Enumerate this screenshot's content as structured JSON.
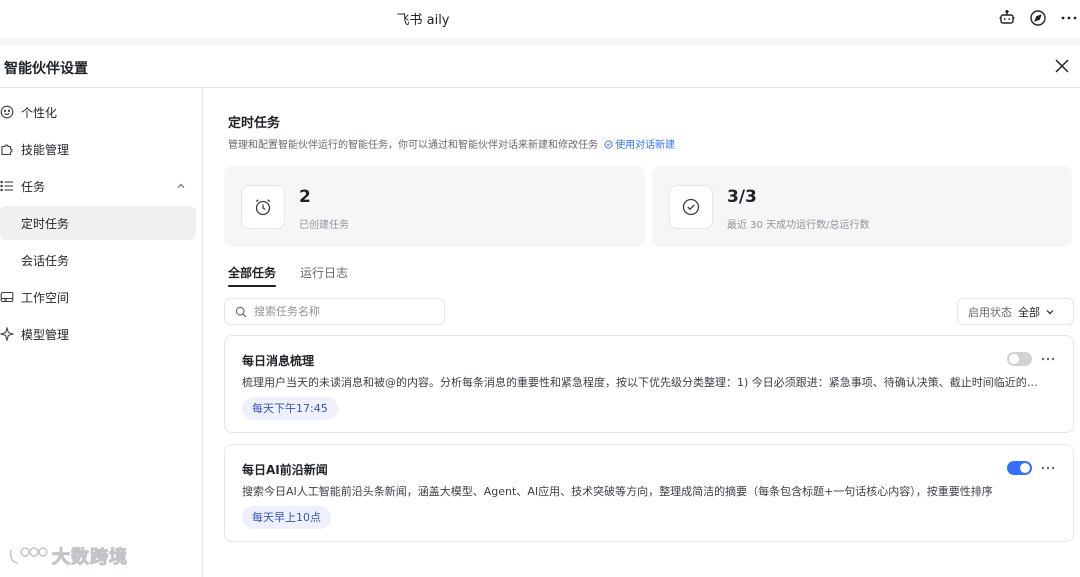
{
  "window": {
    "title": "飞书 aily",
    "top_icons": [
      "robot-icon",
      "compass-icon",
      "more-icon"
    ]
  },
  "panel": {
    "title": "智能伙伴设置",
    "close_icon": "close-icon"
  },
  "sidebar": {
    "items": [
      {
        "label": "个性化",
        "icon": "smile-icon"
      },
      {
        "label": "技能管理",
        "icon": "puzzle-icon"
      },
      {
        "label": "任务",
        "icon": "list-icon"
      },
      {
        "label": "定时任务",
        "selected": true
      },
      {
        "label": "会话任务"
      },
      {
        "label": "工作空间",
        "icon": "workspace-icon"
      },
      {
        "label": "模型管理",
        "icon": "sparkle-icon"
      }
    ]
  },
  "main": {
    "title": "定时任务",
    "description": "管理和配置智能伙伴运行的智能任务，你可以通过和智能伙伴对话来新建和修改任务",
    "create_link": "使用对话新建",
    "stats": [
      {
        "value": "2",
        "label": "已创建任务",
        "icon": "alarm-clock-icon"
      },
      {
        "value": "3/3",
        "label": "最近 30 天成功运行数/总运行数",
        "icon": "check-circle-icon"
      }
    ],
    "tabs": [
      {
        "label": "全部任务",
        "active": true
      },
      {
        "label": "运行日志",
        "active": false
      }
    ],
    "search": {
      "placeholder": "搜索任务名称",
      "value": ""
    },
    "filter": {
      "label": "启用状态",
      "value": "全部"
    },
    "tasks": [
      {
        "name": "每日消息梳理",
        "description": "梳理用户当天的未读消息和被@的内容。分析每条消息的重要性和紧急程度，按以下优先级分类整理：1) 今日必须跟进：紧急事项、待确认决策、截止时间临近的任务",
        "schedule": "每天下午17:45",
        "enabled": false
      },
      {
        "name": "每日AI前沿新闻",
        "description": "搜索今日AI人工智能前沿头条新闻，涵盖大模型、Agent、AI应用、技术突破等方向，整理成简洁的摘要（每条包含标题+一句话核心内容），按重要性排序",
        "schedule": "每天早上10点",
        "enabled": true
      }
    ]
  },
  "watermark": {
    "text": "大数跨境"
  },
  "colors": {
    "accent": "#3370ff",
    "tag_bg": "#eef1fb",
    "tag_text": "#3354c4",
    "card_bg": "#f5f6f7"
  }
}
